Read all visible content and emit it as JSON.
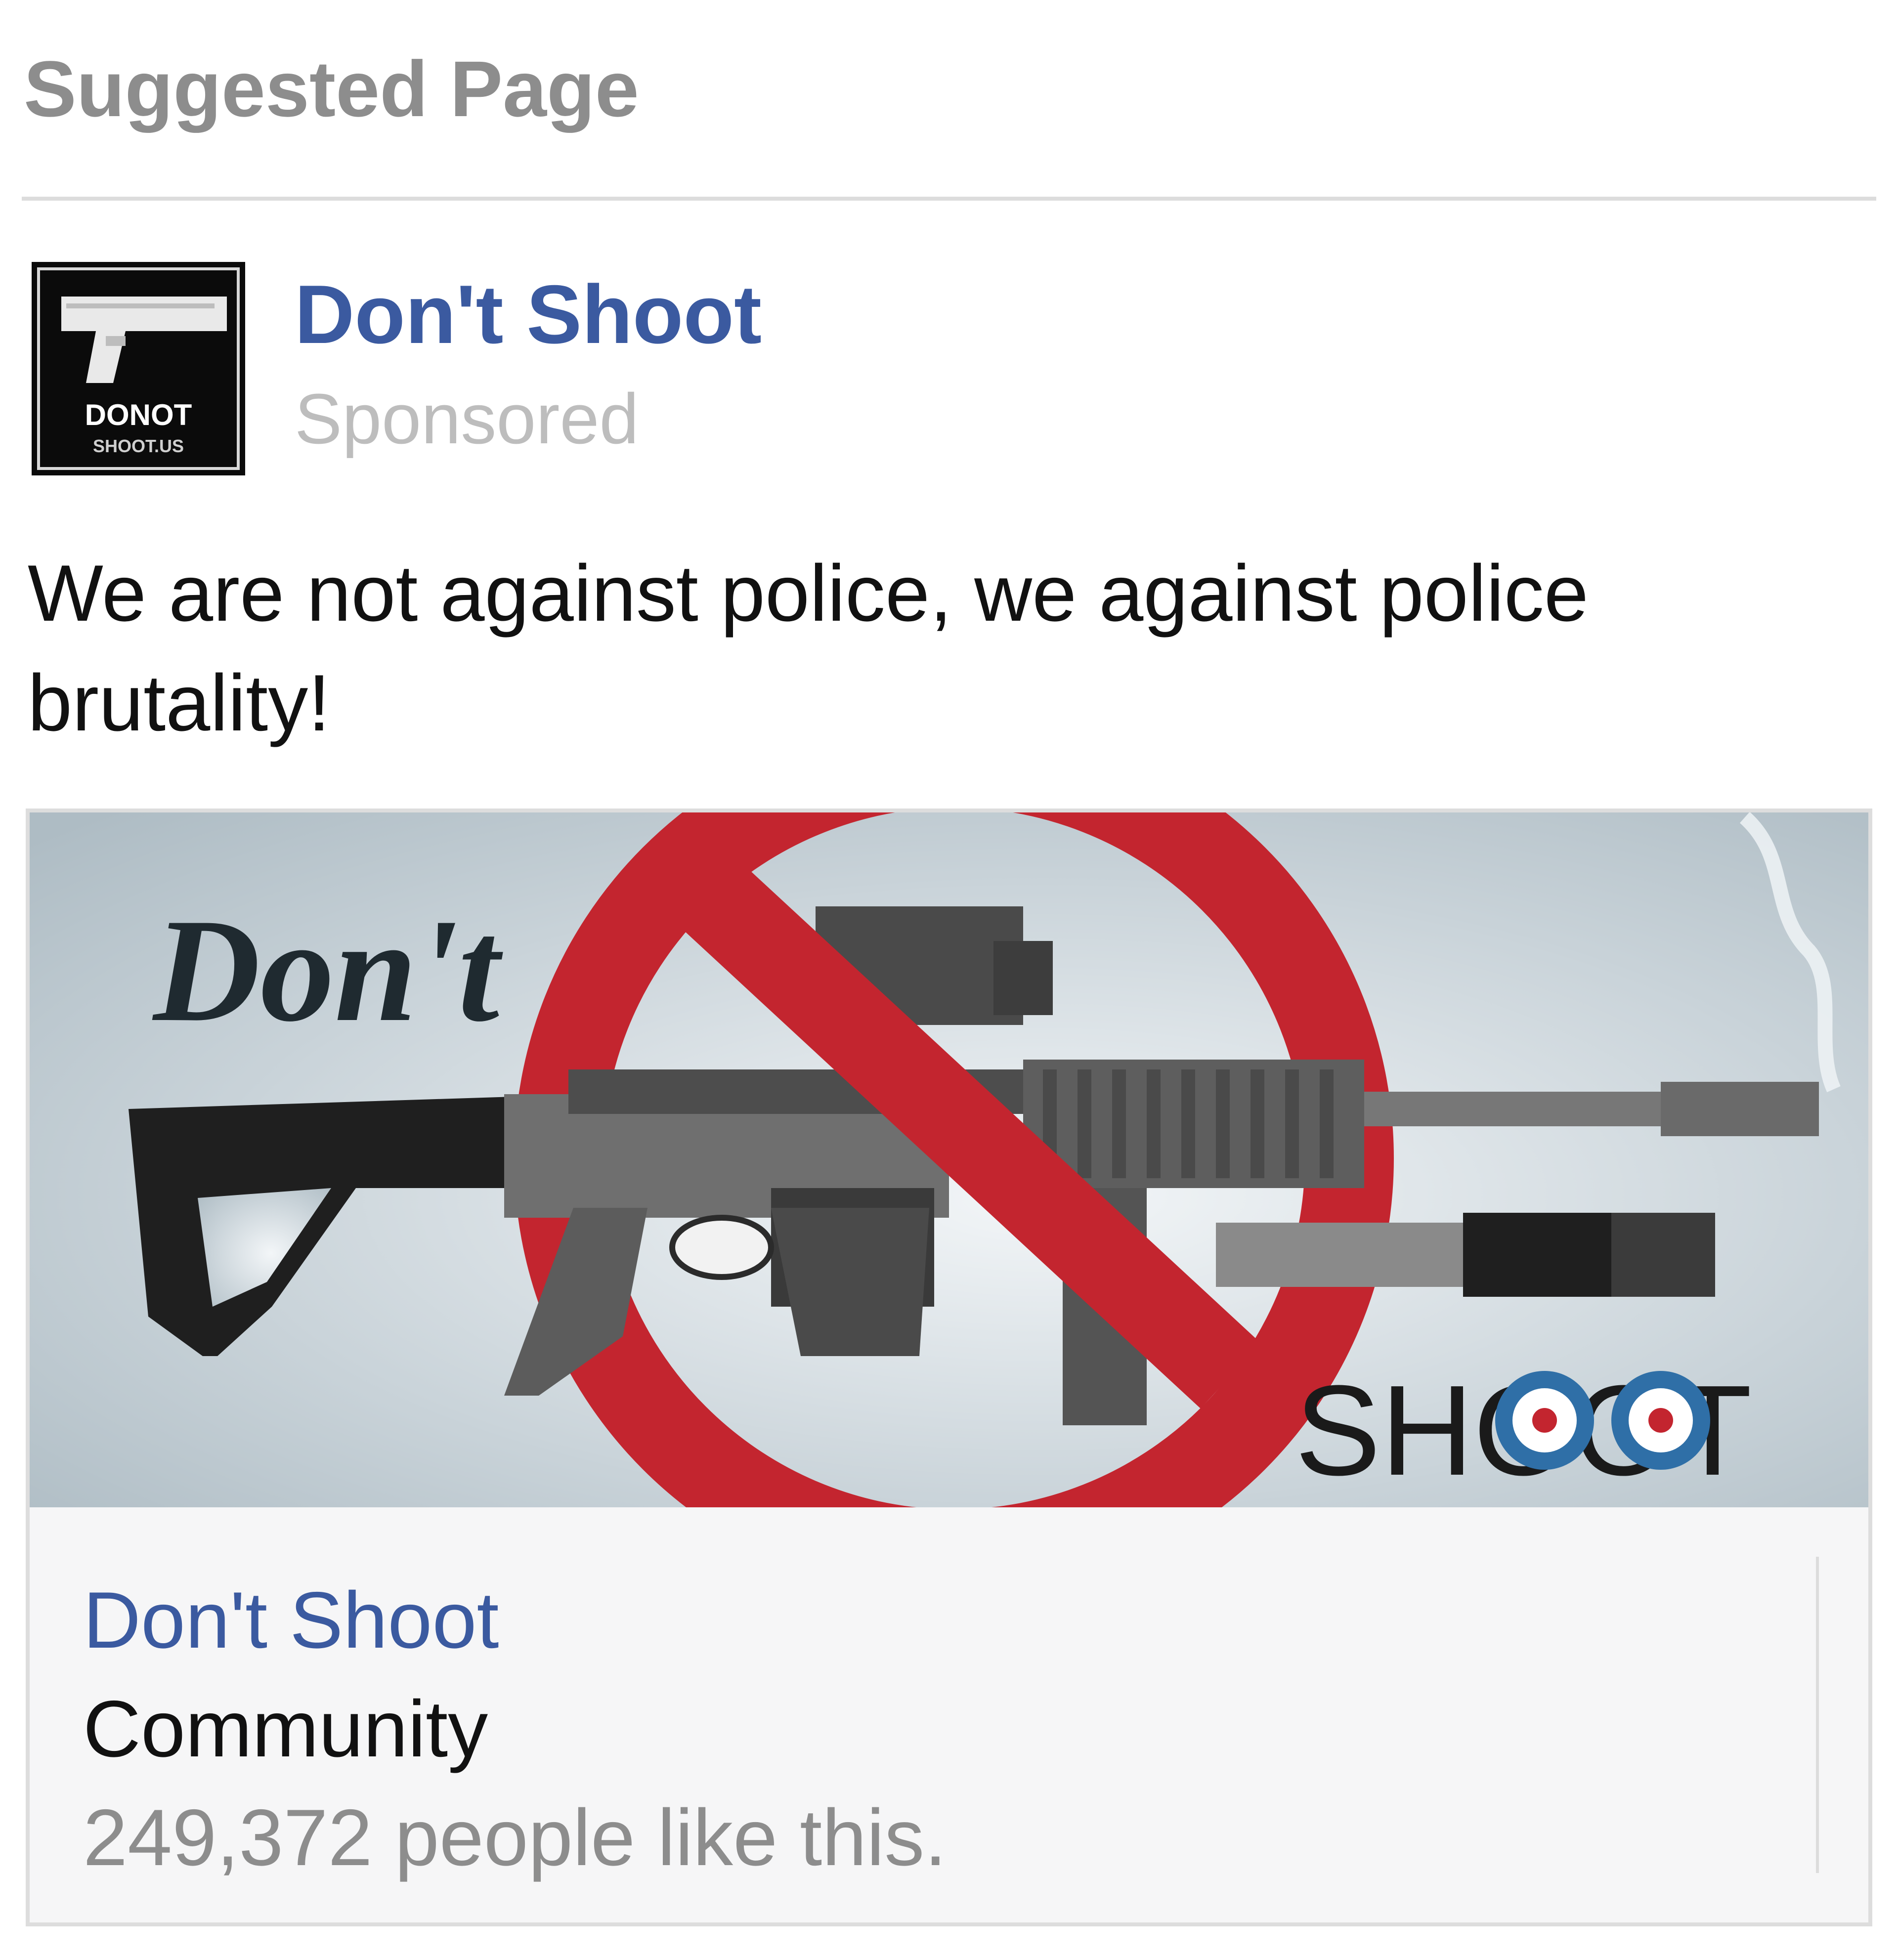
{
  "header": {
    "title": "Suggested Page"
  },
  "post": {
    "page_name": "Don't Shoot",
    "sponsored_label": "Sponsored",
    "avatar_text_line1": "DONOT",
    "avatar_text_line2": "SHOOT.US",
    "text": "We are not against police, we against police brutality!"
  },
  "ad": {
    "image_text_top": "Don't",
    "image_text_bottom": "SHOOT",
    "page_name": "Don't Shoot",
    "category": "Community",
    "likes_text": "249,372 people like this."
  },
  "colors": {
    "link_blue": "#3b5aa0",
    "muted_gray": "#8d8d8d",
    "no_sign_red": "#c3252f",
    "target_blue": "#2f6fa7"
  },
  "icons": [
    "pistol-icon",
    "rifle-icon",
    "no-sign-icon",
    "target-icon"
  ]
}
